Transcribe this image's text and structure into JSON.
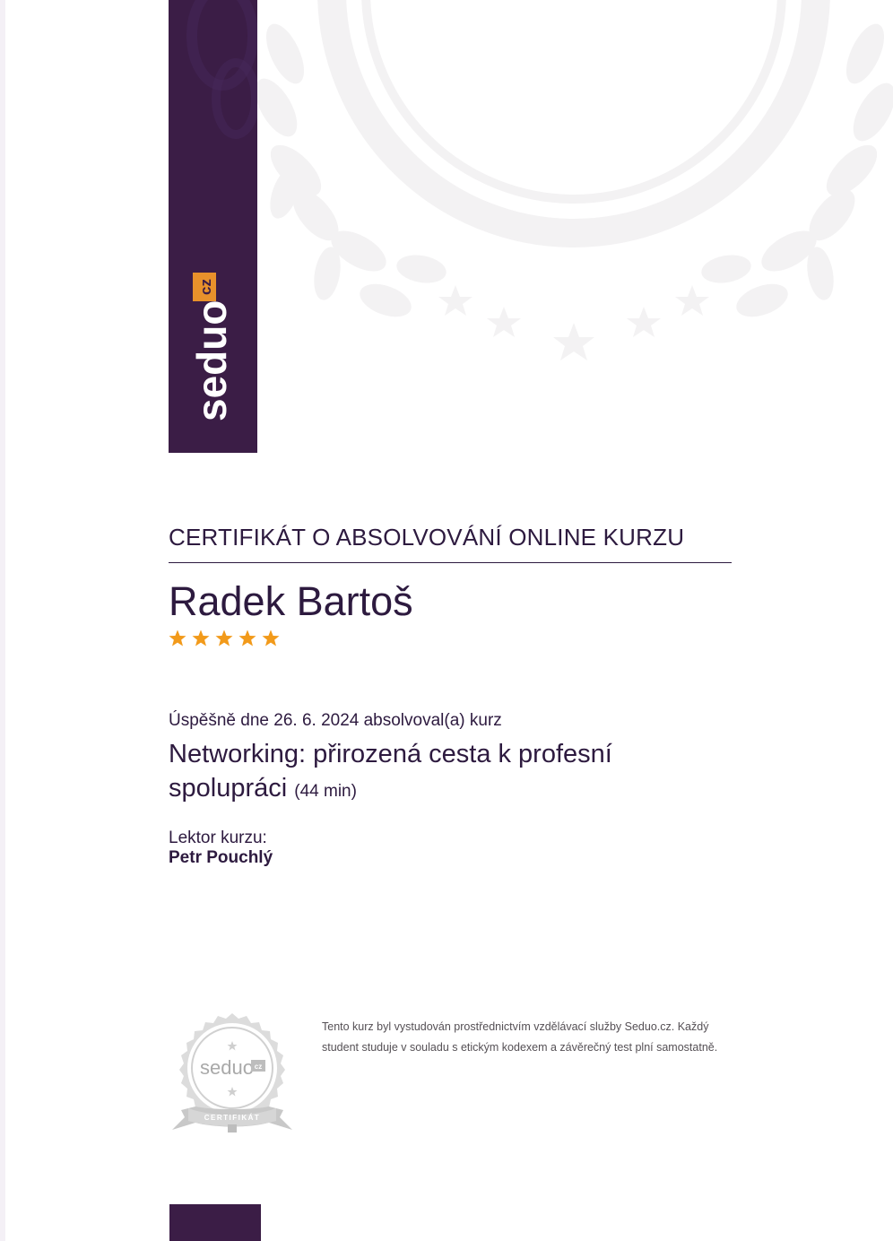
{
  "brand": {
    "logo_text": "seduo",
    "logo_suffix": "cz",
    "primary_color": "#3b1d46",
    "accent_color": "#e8912b",
    "star_color": "#f29a1a"
  },
  "certificate": {
    "title": "CERTIFIKÁT O ABSOLVOVÁNÍ ONLINE KURZU",
    "student_name": "Radek Bartoš",
    "rating_stars": 5,
    "completed_line": "Úspěšně dne 26. 6. 2024 absolvoval(a) kurz",
    "course_name": "Networking: přirozená cesta k profesní spolupráci",
    "course_duration": "(44 min)",
    "lector_label": "Lektor kurzu:",
    "lector_name": "Petr Pouchlý"
  },
  "seal": {
    "logo_text": "seduo",
    "logo_suffix": "cz",
    "ribbon_text": "CERTIFIKÁT"
  },
  "footer": {
    "note": "Tento kurz byl vystudován prostřednictvím vzdělávací služby Seduo.cz. Každý student studuje v souladu s etickým kodexem a závěrečný test plní samostatně."
  },
  "icons": {
    "star": "star-icon",
    "watermark": "laurel-wreath-icon",
    "seal": "certificate-seal-icon"
  }
}
